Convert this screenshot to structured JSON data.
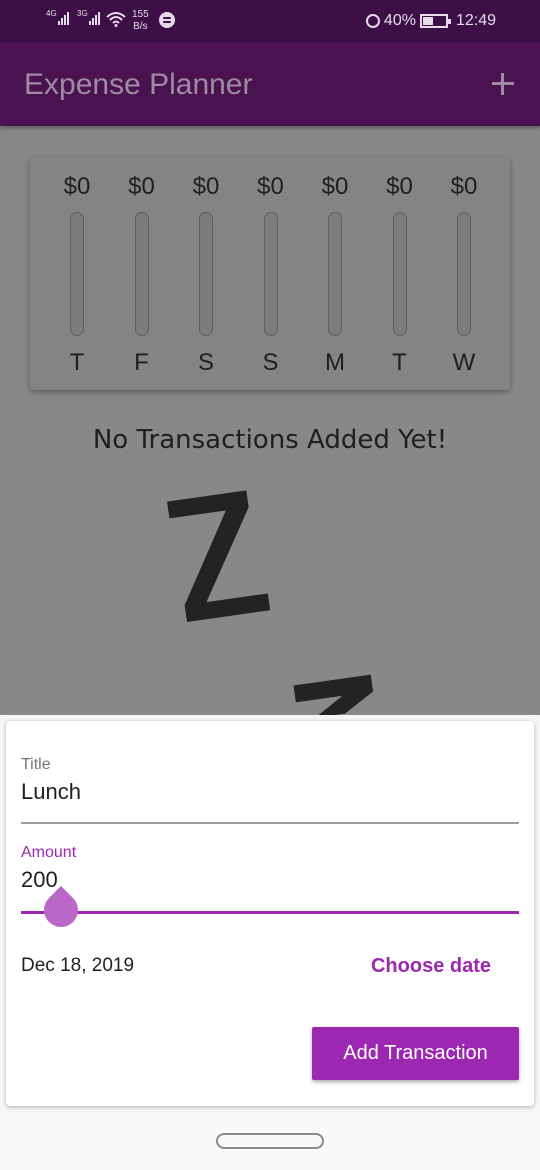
{
  "status_bar": {
    "network_1": "4G",
    "network_2": "3G",
    "speed_value": "155",
    "speed_unit": "B/s",
    "battery": "40%",
    "time": "12:49",
    "icons": [
      "signal-icon",
      "wifi-icon",
      "spotify-icon",
      "alarm-icon",
      "battery-charging-icon"
    ]
  },
  "app_bar": {
    "title": "Expense Planner",
    "action_icon": "add-icon"
  },
  "chart": {
    "bars": [
      {
        "day": "T",
        "amount": "$0",
        "fill_fraction": 0
      },
      {
        "day": "F",
        "amount": "$0",
        "fill_fraction": 0
      },
      {
        "day": "S",
        "amount": "$0",
        "fill_fraction": 0
      },
      {
        "day": "S",
        "amount": "$0",
        "fill_fraction": 0
      },
      {
        "day": "M",
        "amount": "$0",
        "fill_fraction": 0
      },
      {
        "day": "T",
        "amount": "$0",
        "fill_fraction": 0
      },
      {
        "day": "W",
        "amount": "$0",
        "fill_fraction": 0
      }
    ]
  },
  "empty_state": {
    "message": "No Transactions Added Yet!",
    "illustration": "zzz-sleep-illustration"
  },
  "form": {
    "title_label": "Title",
    "title_value": "Lunch",
    "amount_label": "Amount",
    "amount_value": "200",
    "date_value": "Dec 18, 2019",
    "choose_date_label": "Choose date",
    "submit_label": "Add Transaction"
  },
  "colors": {
    "primary": "#9c27b0",
    "app_bar": "#4b1252",
    "status_bar": "#3d0f47",
    "scrim": "#888888"
  }
}
